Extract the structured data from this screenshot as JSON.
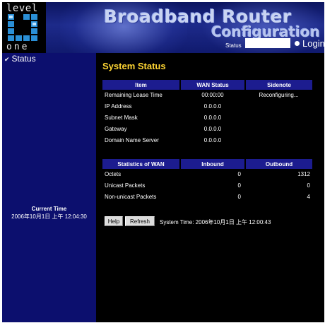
{
  "logo": {
    "top_text": "level",
    "bottom_text": "one",
    "mark_color": "#2a8fd6"
  },
  "banner": {
    "title": "Broadband Router",
    "subtitle": "Configuration",
    "status_label": "Status",
    "status_value": "",
    "login_label": "Login"
  },
  "sidebar": {
    "menu_status": "Status",
    "current_time_label": "Current Time",
    "current_time_value": "2006年10月1日 上午 12:04:30"
  },
  "main": {
    "title": "System Status",
    "wan_table": {
      "headers": [
        "Item",
        "WAN Status",
        "Sidenote"
      ],
      "rows": [
        [
          "Remaining Lease Time",
          "00:00:00",
          "Reconfiguring..."
        ],
        [
          "IP Address",
          "0.0.0.0",
          ""
        ],
        [
          "Subnet Mask",
          "0.0.0.0",
          ""
        ],
        [
          "Gateway",
          "0.0.0.0",
          ""
        ],
        [
          "Domain Name Server",
          "0.0.0.0",
          ""
        ]
      ]
    },
    "stats_table": {
      "headers": [
        "Statistics of WAN",
        "Inbound",
        "Outbound"
      ],
      "rows": [
        [
          "Octets",
          "0",
          "1312"
        ],
        [
          "Unicast Packets",
          "0",
          "0"
        ],
        [
          "Non-unicast Packets",
          "0",
          "4"
        ]
      ]
    },
    "help_label": "Help",
    "refresh_label": "Refresh",
    "system_time": "System Time: 2006年10月1日 上午 12:00:43"
  },
  "colors": {
    "sidebar_bg": "#0c0f6e",
    "header_row_bg": "#1c1c8f",
    "title_color": "#ffd633"
  }
}
